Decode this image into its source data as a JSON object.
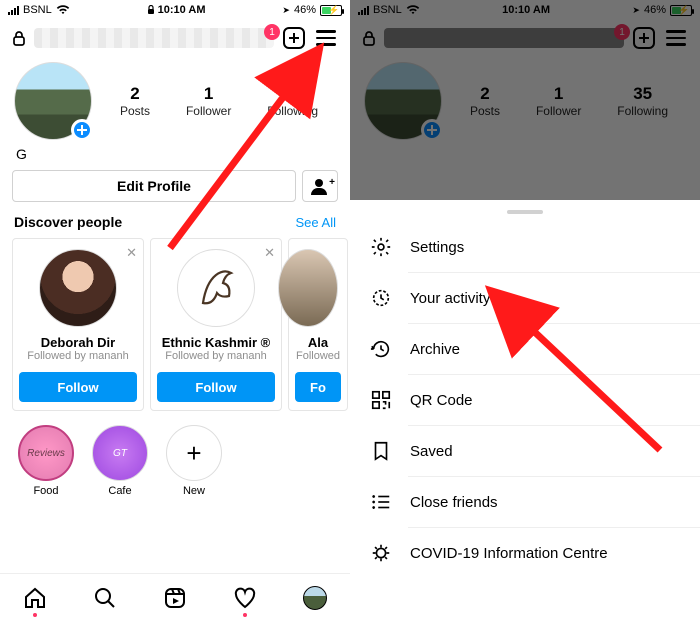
{
  "status": {
    "carrier": "BSNL",
    "time": "10:10 AM",
    "battery_pct": "46%",
    "location_arrow": "➤"
  },
  "header": {
    "notif_count": "1"
  },
  "profile": {
    "display_name": "G",
    "stats": {
      "posts_n": "2",
      "posts_l": "Posts",
      "followers_n": "1",
      "followers_l": "Follower",
      "following_n": "35",
      "following_l": "Following"
    },
    "edit_label": "Edit Profile"
  },
  "discover": {
    "title": "Discover people",
    "see_all": "See All",
    "cards": [
      {
        "name": "Deborah Dir",
        "sub": "Followed by mananh",
        "btn": "Follow"
      },
      {
        "name": "Ethnic Kashmir ®",
        "sub": "Followed by mananh",
        "btn": "Follow"
      },
      {
        "name": "Ala",
        "sub": "Followed",
        "btn": "Fo"
      }
    ]
  },
  "highlights": [
    {
      "label": "Food",
      "text": "Reviews"
    },
    {
      "label": "Cafe",
      "text": "GT"
    },
    {
      "label": "New",
      "text": "+"
    }
  ],
  "menu": {
    "settings": "Settings",
    "activity": "Your activity",
    "archive": "Archive",
    "qr": "QR Code",
    "saved": "Saved",
    "close_friends": "Close friends",
    "covid": "COVID-19 Information Centre"
  }
}
